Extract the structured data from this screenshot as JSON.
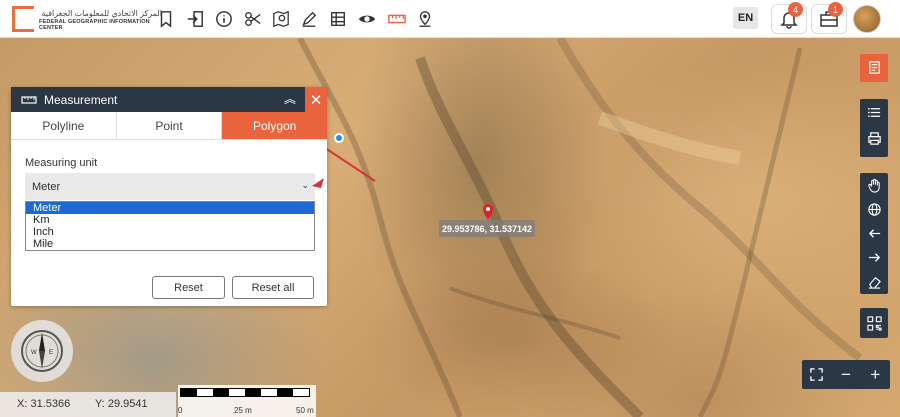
{
  "header": {
    "logo_arabic": "المركز الاتحادي للمعلومات الجغرافية",
    "logo_english": "FEDERAL GEOGRAPHIC INFORMATION CENTER",
    "language": "EN",
    "notifications_count": "4",
    "briefcase_count": "1",
    "tools": [
      "bookmark-icon",
      "login-icon",
      "info-icon",
      "scissors-icon",
      "map-search-icon",
      "draw-icon",
      "table-icon",
      "eye-icon",
      "measure-icon",
      "location-pin-icon"
    ]
  },
  "measurement": {
    "title": "Measurement",
    "tabs": [
      {
        "label": "Polyline",
        "active": false
      },
      {
        "label": "Point",
        "active": false
      },
      {
        "label": "Polygon",
        "active": true
      }
    ],
    "unit_label": "Measuring unit",
    "selected_unit": "Meter",
    "unit_options": [
      "Meter",
      "Km",
      "Inch",
      "Mile"
    ],
    "reset_label": "Reset",
    "reset_all_label": "Reset all"
  },
  "map": {
    "marker_coords": "29.953786, 31.537142",
    "cursor_x": "X: 31.5366",
    "cursor_y": "Y: 29.9541",
    "scale_labels": [
      "0",
      "25 m",
      "50 m"
    ]
  },
  "colors": {
    "accent": "#e9643c",
    "panel_dark": "#2c3745",
    "select_highlight": "#1a6ad1"
  }
}
